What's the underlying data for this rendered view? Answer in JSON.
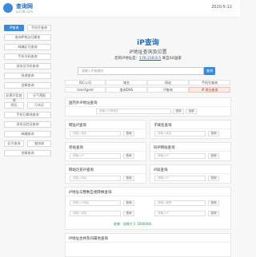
{
  "header": {
    "logo_title": "查询网",
    "logo_sub": "ip138.com",
    "date": "2020-5-11"
  },
  "sidebar": {
    "items": [
      {
        "label": "iP查询",
        "active": true
      },
      {
        "label": "手机号查询",
        "active": false
      },
      {
        "label": "查询IP地址归属地",
        "active": false
      },
      {
        "label": "邮编区号查询",
        "active": false
      },
      {
        "label": "手机号码查询",
        "active": false
      },
      {
        "label": "身份证号码查询",
        "active": false
      },
      {
        "label": "快递查询",
        "active": false
      },
      {
        "label": "违章查询",
        "active": false
      },
      {
        "label": "彩票开奖查询",
        "active": false
      },
      {
        "label": "天气预报",
        "active": false
      },
      {
        "label": "阴历",
        "active": false
      },
      {
        "label": "万年历",
        "active": false
      },
      {
        "label": "手机归属地查询",
        "active": false
      },
      {
        "label": "身份证验证查询",
        "active": false
      },
      {
        "label": "邮编查询",
        "active": false
      },
      {
        "label": "区号查询",
        "active": false
      },
      {
        "label": "查快递",
        "active": false
      },
      {
        "label": "违章查询",
        "active": false
      }
    ]
  },
  "hero": {
    "title": "iP查询",
    "subtitle": "iP地址查询及位置",
    "ip_prefix": "您的iP地址是：",
    "ip": "176.218.6.5",
    "ip_suffix": "  来自XX国家"
  },
  "search": {
    "placeholder": "请输入iP或域名",
    "button": "查询"
  },
  "tabs": [
    {
      "label": "IDC公司",
      "active": false
    },
    {
      "label": "域名",
      "active": false
    },
    {
      "label": "网站",
      "active": false
    },
    {
      "label": "手机号查询",
      "active": false
    },
    {
      "label": "UserAgent",
      "active": false
    },
    {
      "label": "查询DNS",
      "active": false
    },
    {
      "label": "iP查询",
      "active": false
    },
    {
      "label": "iP 地址查询",
      "active": true
    }
  ],
  "cards": {
    "c1": {
      "title": "国内外iP地址查询",
      "input": "请输入iP或域名",
      "btn1": "查询",
      "btn2": "全部"
    },
    "c2": {
      "title": "网址iP查询",
      "input": "请输入域名",
      "btn": "查询"
    },
    "c3": {
      "title": "子域名查询",
      "input": "请输入域名",
      "btn": "查询"
    },
    "c4": {
      "title": "旁站查询",
      "input": "请输入iP",
      "btn": "查询"
    },
    "c5": {
      "title": "同iP网站查询",
      "input": "请输入iP",
      "btn": "查询"
    },
    "c6": {
      "title": "网站历史iP查询",
      "input": "请输入网址",
      "btn": "查询"
    },
    "c7": {
      "title": "iP段查询",
      "input": "请输入iP",
      "btn": "查询"
    },
    "c8": {
      "title": "iP地址与整数互相转换查询",
      "rows": [
        {
          "input": "请输入iP地址",
          "btn": "查询"
        },
        {
          "input": "请输入整数",
          "btn": "查询"
        }
      ],
      "rows2": [
        {
          "input": "请输入域名",
          "btn": "查询"
        },
        {
          "input": "请输入iP",
          "btn": "查询"
        }
      ],
      "result": "结果：如果大于 1000000"
    },
    "c9": {
      "title": "IP地址合并及归属地查询"
    }
  }
}
